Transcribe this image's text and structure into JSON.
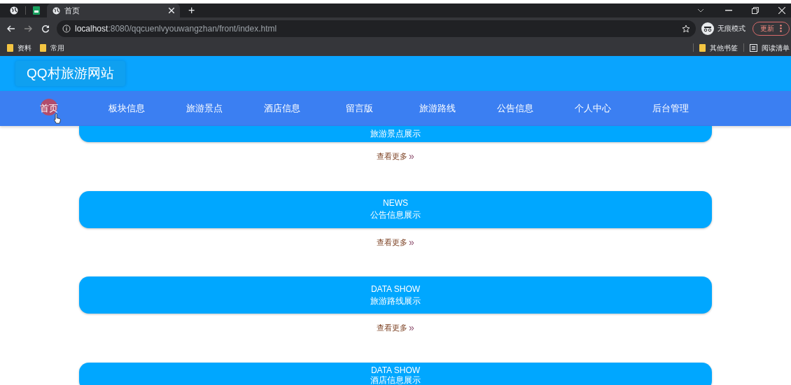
{
  "browser": {
    "tabs": [
      {
        "title": "首页",
        "selected": true
      }
    ],
    "new_tab": "+",
    "url_host": "localhost",
    "url_rest": ":8080/qqcuenlvyouwangzhan/front/index.html",
    "incognito": "无痕模式",
    "update": "更新",
    "bookmarks": [
      "资料",
      "常用"
    ],
    "bookmarks_right": [
      "其他书签",
      "阅读清单"
    ]
  },
  "site": {
    "title": "QQ村旅游网站",
    "nav": [
      {
        "label": "首页",
        "selected": true
      },
      {
        "label": "板块信息",
        "selected": false
      },
      {
        "label": "旅游景点",
        "selected": false
      },
      {
        "label": "酒店信息",
        "selected": false
      },
      {
        "label": "留言版",
        "selected": false
      },
      {
        "label": "旅游路线",
        "selected": false
      },
      {
        "label": "公告信息",
        "selected": false
      },
      {
        "label": "个人中心",
        "selected": false
      },
      {
        "label": "后台管理",
        "selected": false
      }
    ],
    "sections": [
      {
        "title": "旅游景点展示",
        "more": "查看更多",
        "more_icon": "»"
      },
      {
        "eyebrow": "NEWS",
        "title": "公告信息展示",
        "more": "查看更多",
        "more_icon": "»"
      },
      {
        "eyebrow": "DATA SHOW",
        "title": "旅游路线展示",
        "more": "查看更多",
        "more_icon": "»"
      },
      {
        "eyebrow": "DATA SHOW",
        "title": "酒店信息展示"
      }
    ]
  }
}
